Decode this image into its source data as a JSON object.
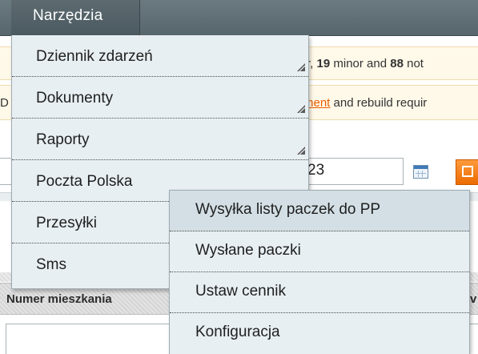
{
  "topbar": {
    "tab_label": "Narzędzia"
  },
  "notices": {
    "notice1": {
      "prefix": "r, ",
      "minor_count": "19",
      "minor_text": " minor and ",
      "other_count": "88",
      "suffix": " not"
    },
    "notice2": {
      "edge_char": "D",
      "link_text": "ment",
      "suffix": " and rebuild requir"
    }
  },
  "date_filter": {
    "left_glyph": "3",
    "value_fragment": "23"
  },
  "grid": {
    "header_label": "Numer mieszkania",
    "header_right_fragment": "v"
  },
  "menu": {
    "items": [
      {
        "label": "Dziennik zdarzeń",
        "has_submenu": true
      },
      {
        "label": "Dokumenty",
        "has_submenu": true
      },
      {
        "label": "Raporty",
        "has_submenu": true
      },
      {
        "label": "Poczta Polska",
        "has_submenu": true
      },
      {
        "label": "Przesyłki",
        "has_submenu": false
      },
      {
        "label": "Sms",
        "has_submenu": false
      }
    ]
  },
  "submenu": {
    "items": [
      {
        "label": "Wysyłka listy paczek do PP",
        "active": true
      },
      {
        "label": "Wysłane paczki",
        "active": false
      },
      {
        "label": "Ustaw cennik",
        "active": false
      },
      {
        "label": "Konfiguracja",
        "active": false
      }
    ]
  },
  "colors": {
    "menu_bg": "#e8eff3",
    "active_bg": "#d3dfe5",
    "accent_orange": "#eb6c00",
    "link_orange": "#eb5e00",
    "notice_bg": "#fff9e9"
  }
}
